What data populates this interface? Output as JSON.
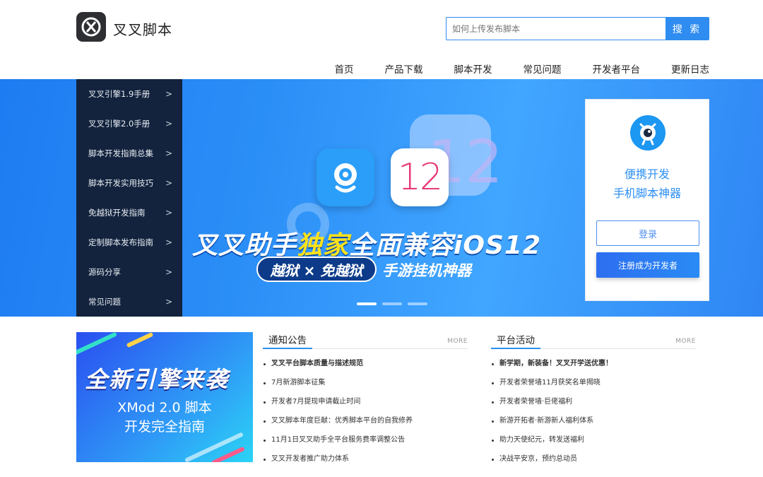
{
  "header": {
    "logo_text": "叉叉脚本",
    "search": {
      "placeholder": "如何上传发布脚本",
      "button": "搜 索"
    }
  },
  "nav": [
    "首页",
    "产品下载",
    "脚本开发",
    "常见问题",
    "开发者平台",
    "更新日志"
  ],
  "sidebar": {
    "items": [
      {
        "label": "叉叉引擎1.9手册",
        "arrow": ">"
      },
      {
        "label": "叉叉引擎2.0手册",
        "arrow": ">"
      },
      {
        "label": "脚本开发指南总集",
        "arrow": ">"
      },
      {
        "label": "脚本开发实用技巧",
        "arrow": ">"
      },
      {
        "label": "免越狱开发指南",
        "arrow": ">"
      },
      {
        "label": "定制脚本发布指南",
        "arrow": ">"
      },
      {
        "label": "源码分享",
        "arrow": ">"
      },
      {
        "label": "常见问题",
        "arrow": ">"
      }
    ]
  },
  "banner": {
    "ios_number": "12",
    "headline_before": "叉叉助手",
    "headline_highlight": "独家",
    "headline_after": "全面兼容iOS12",
    "pill_text": "越狱 × 免越狱",
    "subline": "手游挂机神器",
    "slides": 3,
    "active_slide": 1
  },
  "card": {
    "line1": "便携开发",
    "line2": "手机脚本神器",
    "login": "登录",
    "register": "注册成为开发者"
  },
  "promo": {
    "title": "全新引擎来袭",
    "sub1": "XMod 2.0 脚本",
    "sub2": "开发完全指南"
  },
  "notice": {
    "title": "通知公告",
    "more": "MORE",
    "items": [
      "叉叉平台脚本质量与描述规范",
      "7月新游脚本征集",
      "开发者7月提现申请截止时间",
      "叉叉脚本年度巨献：优秀脚本平台的自我修养",
      "11月1日叉叉助手全平台服务费率调整公告",
      "叉叉开发者推广助力体系"
    ]
  },
  "activity": {
    "title": "平台活动",
    "more": "MORE",
    "items": [
      "新学期，新装备！叉叉开学送优惠！",
      "开发者荣誉墙11月获奖名单揭晓",
      "开发者荣誉墙·巨佬福利",
      "新游开拓者·新游新人福利体系",
      "助力天使纪元，转发送福利",
      "决战平安京，预约总动员"
    ]
  },
  "colors": {
    "accent": "#2b8ff4",
    "sidebar_bg": "#13233d",
    "highlight": "#ffe21a"
  }
}
